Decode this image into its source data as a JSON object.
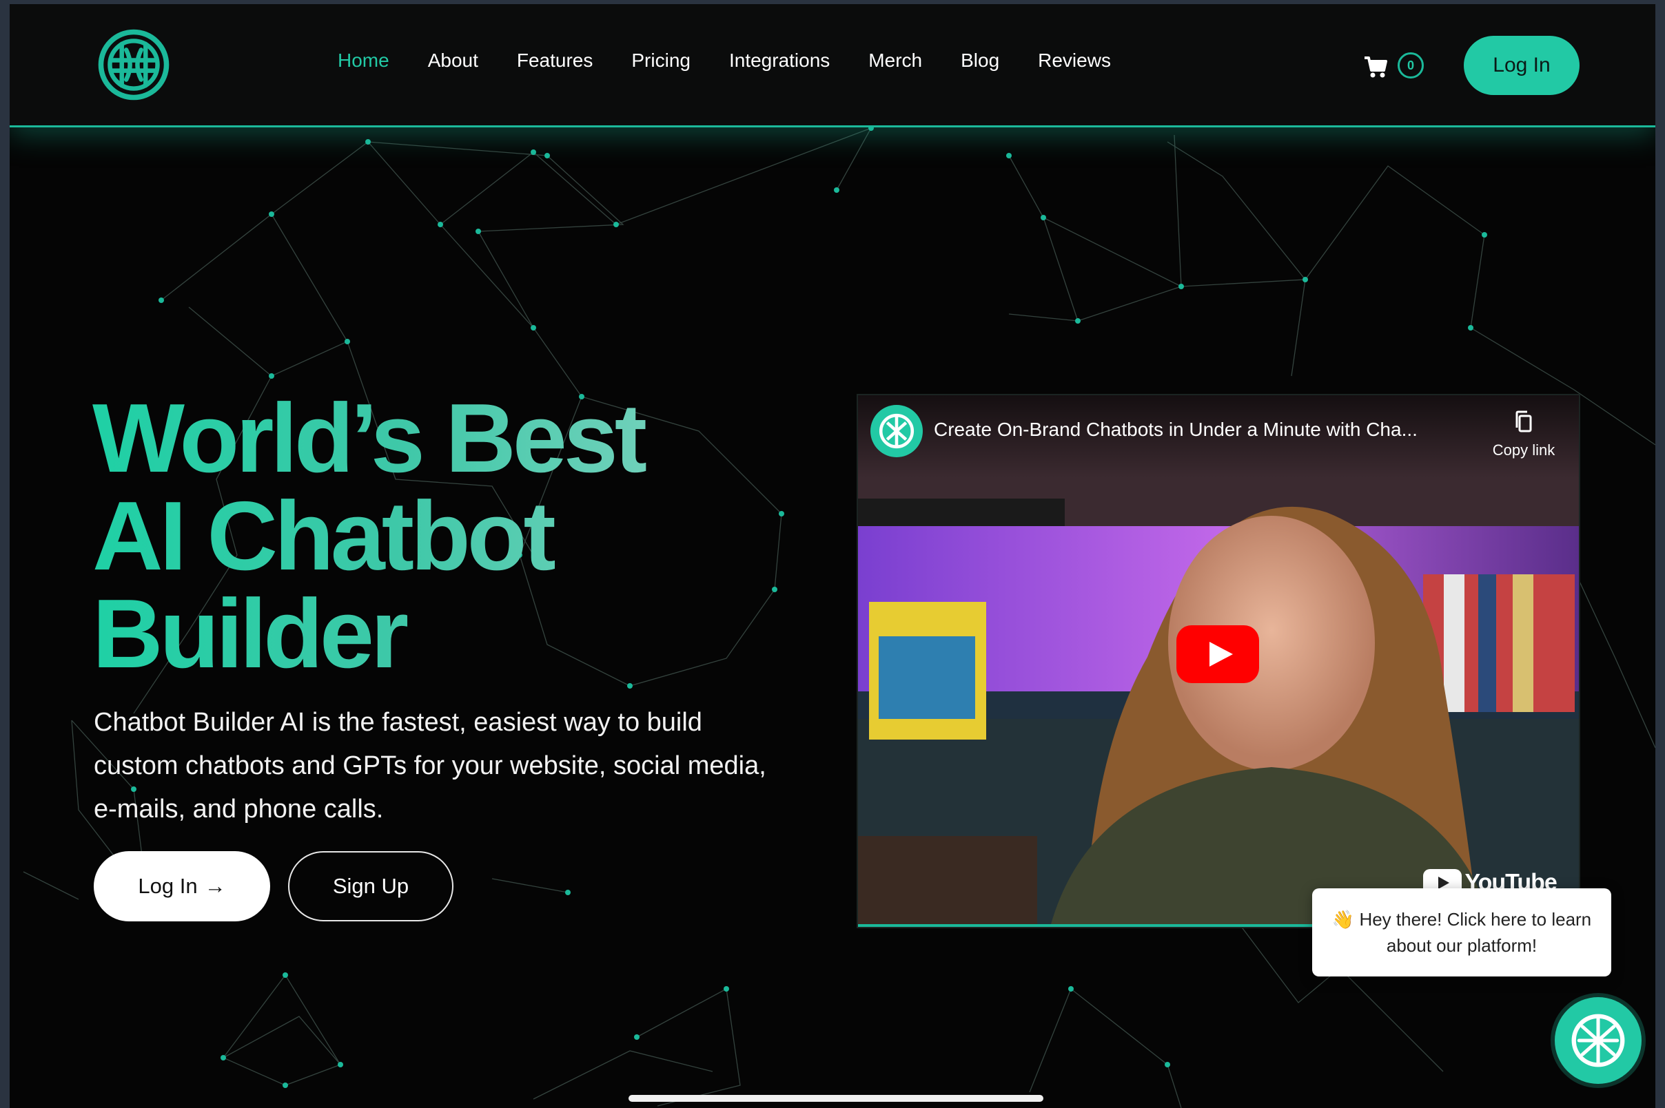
{
  "nav": {
    "items": [
      {
        "label": "Home",
        "active": true
      },
      {
        "label": "About"
      },
      {
        "label": "Features"
      },
      {
        "label": "Pricing"
      },
      {
        "label": "Integrations"
      },
      {
        "label": "Merch"
      },
      {
        "label": "Blog"
      },
      {
        "label": "Reviews"
      }
    ],
    "cart_count": "0",
    "login_label": "Log In"
  },
  "hero": {
    "title_lines": [
      "World’s Best",
      "AI Chatbot",
      "Builder"
    ],
    "description": "Chatbot Builder AI is the fastest, easiest way to build custom chatbots and GPTs for your website, social media, e-mails, and phone calls.",
    "login_label": "Log In",
    "login_arrow": "→",
    "signup_label": "Sign Up"
  },
  "video": {
    "title": "Create On-Brand Chatbots in Under a Minute with Cha...",
    "copy_link_label": "Copy link",
    "platform_label": "YouTube"
  },
  "chat": {
    "popup_text": "👋 Hey there! Click here to learn about our platform!"
  },
  "colors": {
    "accent": "#22c9a5",
    "background": "#050505",
    "header_bg": "#0b0c0c"
  },
  "icons": {
    "logo": "brand-knot-logo-icon",
    "cart": "shopping-cart-icon",
    "copy": "copy-icon",
    "play": "youtube-play-icon",
    "chat": "chat-launcher-logo-icon"
  }
}
